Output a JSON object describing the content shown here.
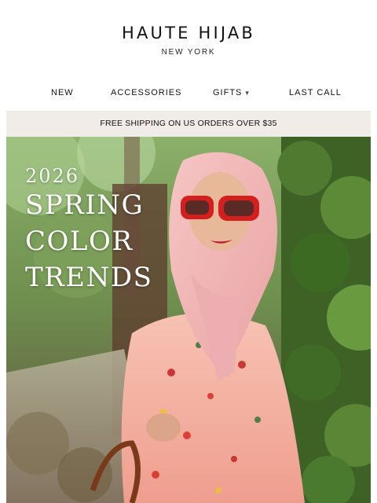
{
  "brand": {
    "name": "HAUTE HIJAB",
    "location": "NEW YORK"
  },
  "nav": {
    "items": [
      {
        "label": "NEW"
      },
      {
        "label": "ACCESSORIES"
      },
      {
        "label": "GIFTS"
      },
      {
        "label": "LAST CALL"
      }
    ],
    "gifts_icon": "chevron-down-icon"
  },
  "promo": {
    "text": "FREE SHIPPING ON US ORDERS OVER $35"
  },
  "hero": {
    "year": "2026",
    "title_lines": [
      "SPRING",
      "COLOR",
      "TRENDS"
    ],
    "colors": {
      "hijab": "#f2b9b8",
      "dress": "#f4b8a8",
      "sunglasses": "#d51f1f",
      "foliage": "#4f7a2f",
      "background": "#7b9a5a"
    }
  }
}
